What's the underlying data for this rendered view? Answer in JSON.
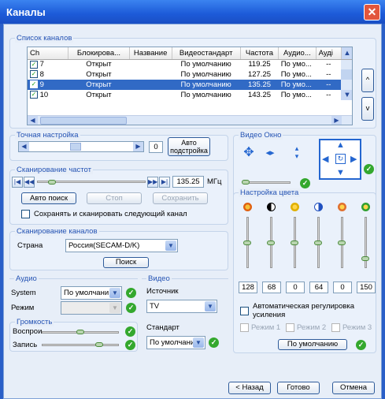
{
  "window": {
    "title": "Каналы"
  },
  "channels": {
    "group_title": "Список каналов",
    "columns": [
      "Ch",
      "Блокирова...",
      "Название",
      "Видеостандарт",
      "Частота",
      "Аудио...",
      "Ауді"
    ],
    "rows": [
      {
        "ch": "7",
        "lock": "Открыт",
        "name": "",
        "std": "По умолчанию",
        "freq": "119.25",
        "audio": "По умо...",
        "a2": "--"
      },
      {
        "ch": "8",
        "lock": "Открыт",
        "name": "",
        "std": "По умолчанию",
        "freq": "127.25",
        "audio": "По умо...",
        "a2": "--"
      },
      {
        "ch": "9",
        "lock": "Открыт",
        "name": "",
        "std": "По умолчанию",
        "freq": "135.25",
        "audio": "По умо...",
        "a2": "--"
      },
      {
        "ch": "10",
        "lock": "Открыт",
        "name": "",
        "std": "По умолчанию",
        "freq": "143.25",
        "audio": "По умо...",
        "a2": "--"
      }
    ],
    "up_glyph": "^",
    "down_glyph": "v"
  },
  "fine_tune": {
    "title": "Точная настройка",
    "value": "0",
    "auto_button": "Авто\nподстройка"
  },
  "scan_freq": {
    "title": "Сканирование частот",
    "freq": "135.25",
    "unit": "МГц",
    "auto_search": "Авто поиск",
    "stop": "Стоп",
    "save": "Сохранить",
    "save_scan_next": "Сохранять и сканировать следующий канал"
  },
  "scan_channels": {
    "title": "Сканирование каналов",
    "country_label": "Страна",
    "country_value": "Россия(SECAM-D/K)",
    "search": "Поиск"
  },
  "audio": {
    "title": "Аудио",
    "system_label": "System",
    "system_value": "По умолчани",
    "mode_label": "Режим",
    "mode_value": ""
  },
  "volume": {
    "title": "Громкость",
    "playback_label": "Воспрои",
    "record_label": "Запись"
  },
  "video": {
    "title": "Видео",
    "source_label": "Источник",
    "source_value": "TV",
    "standard_label": "Стандарт",
    "standard_value": "По умолчаник"
  },
  "video_window": {
    "title": "Видео Окно"
  },
  "color": {
    "title": "Настройка цвета",
    "values": [
      "128",
      "68",
      "0",
      "64",
      "0",
      "150"
    ],
    "levels": [
      0.5,
      0.5,
      0.5,
      0.5,
      0.5,
      0.15
    ],
    "icons": [
      "brightness-icon",
      "contrast-icon",
      "hue-icon",
      "saturation-icon",
      "sharpness-icon",
      "gamma-icon"
    ],
    "icon_colors": [
      "#e06010",
      "#000000",
      "#e0b000",
      "#2050c0",
      "#e07030",
      "#30a030"
    ],
    "auto_gain": "Автоматическая регулировка\nусиления",
    "modes": [
      "Режим 1",
      "Режим 2",
      "Режим 3"
    ],
    "default_button": "По умолчанию"
  },
  "footer": {
    "back": "< Назад",
    "done": "Готово",
    "cancel": "Отмена"
  }
}
